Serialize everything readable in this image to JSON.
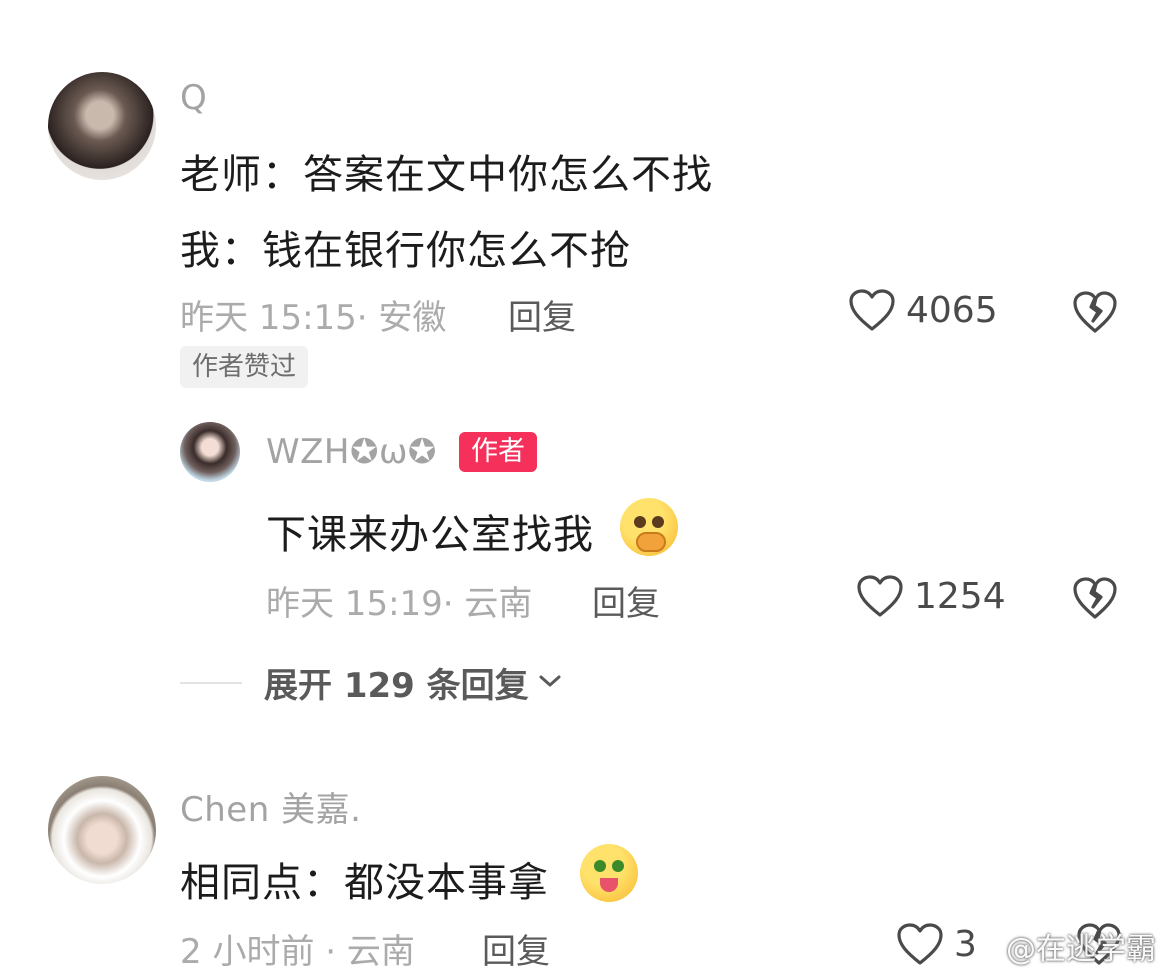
{
  "comments": [
    {
      "username": "Q",
      "lines": [
        "老师：答案在文中你怎么不找",
        "我：钱在银行你怎么不抢"
      ],
      "meta": "昨天 15:15· 安徽",
      "reply_label": "回复",
      "likes": "4065",
      "badge": "作者赞过",
      "avatar_icon": "user-avatar"
    },
    {
      "username": "WZH✪ω✪",
      "author_badge": "作者",
      "text": "下课来办公室找我",
      "emoji": "crying-hands-over-mouth-emoji",
      "meta": "昨天 15:19· 云南",
      "reply_label": "回复",
      "likes": "1254",
      "avatar_icon": "user-avatar"
    },
    {
      "username": "Chen 美嘉.",
      "text": "相同点：都没本事拿",
      "emoji": "money-eyes-tongue-emoji",
      "meta": "2 小时前 · 云南",
      "reply_label": "回复",
      "likes": "3",
      "avatar_icon": "user-avatar"
    }
  ],
  "expand_replies": "展开 129 条回复",
  "watermark": "@在逃学霸",
  "colors": {
    "author_badge": "#f5315b",
    "meta_text": "#ababab",
    "body_text": "#1c1c1c"
  },
  "icons": [
    "heart-icon",
    "broken-heart-icon",
    "chevron-down-icon"
  ]
}
